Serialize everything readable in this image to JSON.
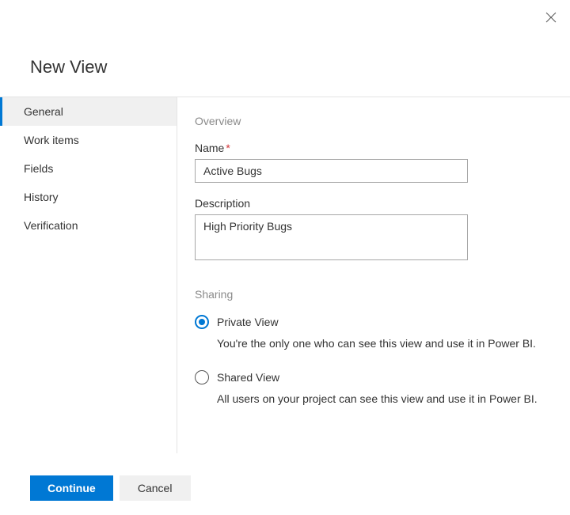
{
  "dialog": {
    "title": "New View"
  },
  "sidebar": {
    "items": [
      {
        "label": "General",
        "selected": true
      },
      {
        "label": "Work items",
        "selected": false
      },
      {
        "label": "Fields",
        "selected": false
      },
      {
        "label": "History",
        "selected": false
      },
      {
        "label": "Verification",
        "selected": false
      }
    ]
  },
  "main": {
    "overview_label": "Overview",
    "name_label": "Name",
    "name_required": "*",
    "name_value": "Active Bugs",
    "description_label": "Description",
    "description_value": "High Priority Bugs",
    "sharing_label": "Sharing",
    "sharing_options": [
      {
        "label": "Private View",
        "desc": "You're the only one who can see this view and use it in Power BI.",
        "selected": true
      },
      {
        "label": "Shared View",
        "desc": "All users on your project can see this view and use it in Power BI.",
        "selected": false
      }
    ]
  },
  "footer": {
    "continue_label": "Continue",
    "cancel_label": "Cancel"
  }
}
